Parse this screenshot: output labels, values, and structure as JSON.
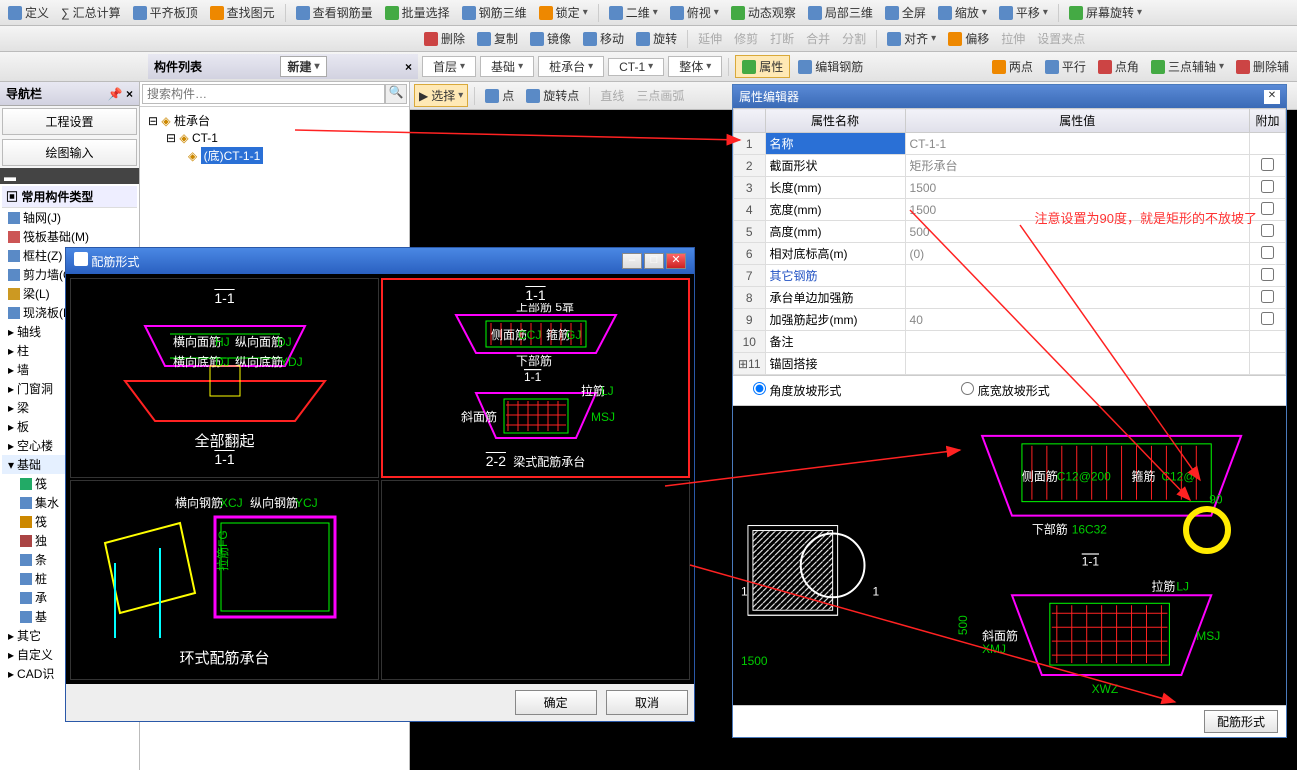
{
  "toolbar1": {
    "items": [
      "定义",
      "汇总计算",
      "平齐板顶",
      "查找图元",
      "查看钢筋量",
      "批量选择",
      "钢筋三维",
      "锁定",
      "二维",
      "俯视",
      "动态观察",
      "局部三维",
      "全屏",
      "缩放",
      "平移",
      "屏幕旋转"
    ]
  },
  "toolbar2": {
    "items": [
      "删除",
      "复制",
      "镜像",
      "移动",
      "旋转",
      "延伸",
      "修剪",
      "打断",
      "合并",
      "分割",
      "对齐",
      "偏移",
      "拉伸",
      "设置夹点"
    ]
  },
  "toolbar3": {
    "layer": "首层",
    "cat": "基础",
    "type": "桩承台",
    "item": "CT-1",
    "mode": "整体",
    "btns": [
      "属性",
      "编辑钢筋",
      "两点",
      "平行",
      "点角",
      "三点辅轴",
      "删除辅"
    ]
  },
  "toolbar4": {
    "items": [
      "选择",
      "点",
      "旋转点",
      "直线",
      "三点画弧"
    ]
  },
  "nav": {
    "title": "导航栏",
    "btn1": "工程设置",
    "btn2": "绘图输入",
    "group": "常用构件类型",
    "items": [
      "轴网(J)",
      "筏板基础(M)",
      "框柱(Z)",
      "剪力墙(Q)",
      "梁(L)",
      "现浇板(B)"
    ],
    "cats": [
      "轴线",
      "柱",
      "墙",
      "门窗洞",
      "梁",
      "板",
      "空心楼",
      "基础",
      "筏",
      "集水",
      "筏",
      "独",
      "条",
      "桩",
      "承",
      "基",
      "其它",
      "自定义",
      "CAD识"
    ]
  },
  "comp": {
    "title": "构件列表",
    "new": "新建",
    "search_ph": "搜索构件…",
    "root": "桩承台",
    "child": "CT-1",
    "leaf": "(底)CT-1-1"
  },
  "prop": {
    "title": "属性编辑器",
    "h_name": "属性名称",
    "h_val": "属性值",
    "h_add": "附加",
    "rows": [
      {
        "n": "1",
        "name": "名称",
        "val": "CT-1-1",
        "blue": false,
        "sel": true
      },
      {
        "n": "2",
        "name": "截面形状",
        "val": "矩形承台"
      },
      {
        "n": "3",
        "name": "长度(mm)",
        "val": "1500"
      },
      {
        "n": "4",
        "name": "宽度(mm)",
        "val": "1500"
      },
      {
        "n": "5",
        "name": "高度(mm)",
        "val": "500"
      },
      {
        "n": "6",
        "name": "相对底标高(m)",
        "val": "(0)"
      },
      {
        "n": "7",
        "name": "其它钢筋",
        "val": "",
        "blue": true
      },
      {
        "n": "8",
        "name": "承台单边加强筋",
        "val": ""
      },
      {
        "n": "9",
        "name": "加强筋起步(mm)",
        "val": "40"
      },
      {
        "n": "10",
        "name": "备注",
        "val": ""
      },
      {
        "n": "11",
        "name": "锚固搭接",
        "val": "",
        "exp": true
      }
    ],
    "radio1": "角度放坡形式",
    "radio2": "底宽放坡形式",
    "note": "注意设置为90度，就是矩形的不放坡了",
    "btn": "配筋形式",
    "diag": {
      "side": "侧面筋",
      "sideval": "C12@200",
      "hoop": "箍筋",
      "hoopval": "C12@",
      "ang": "90",
      "bot": "下部筋",
      "botval": "16C32",
      "sec": "1-1",
      "t": "拉筋",
      "tj": "LJ",
      "xm": "斜面筋",
      "xmj": "XMJ",
      "msj": "MSJ",
      "xwz": "XWZ",
      "h": "500",
      "w": "1500",
      "one": "1"
    }
  },
  "rebar": {
    "title": "配筋形式",
    "cells": [
      {
        "top": "1-1",
        "label": "全部翻起",
        "sub": "1-1"
      },
      {
        "top": "1-1",
        "label": "梁式配筋承台",
        "sub": "2-2"
      },
      {
        "label": "环式配筋承台"
      },
      {
        "label": ""
      }
    ],
    "ok": "确定",
    "cancel": "取消",
    "txt": {
      "sb": "上部筋",
      "hx": "横向面筋",
      "hxj": "HJ",
      "zx": "纵向面筋",
      "zxj": "DJ",
      "hxd": "横向底筋",
      "hxdj": "DJ",
      "zxd": "纵向底筋",
      "zxdj": "YDJ",
      "hx2": "横向钢筋",
      "hx2j": "XCJ",
      "zx2": "纵向钢筋",
      "zx2j": "YCJ",
      "fg": "FG",
      "lj": "拉筋LJ",
      "sec11": "1-1",
      "ff": "斜面筋",
      "ffj": "MSJ"
    }
  }
}
